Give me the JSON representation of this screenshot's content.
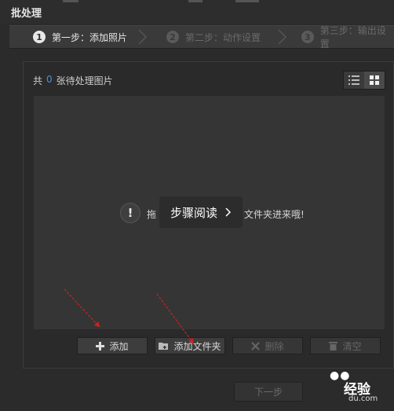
{
  "window": {
    "title": "批处理"
  },
  "steps": [
    {
      "num": "1",
      "label": "第一步：添加照片",
      "state": "active"
    },
    {
      "num": "2",
      "label": "第二步：动作设置",
      "state": "inactive"
    },
    {
      "num": "3",
      "label": "第三步：输出设置",
      "state": "inactive"
    }
  ],
  "panel": {
    "count_prefix": "共",
    "count_value": "0",
    "count_suffix": "张待处理图片"
  },
  "hint": {
    "text_start": "拖",
    "text_end": "文件夹进来哦!",
    "overlay_label": "步骤阅读"
  },
  "actions": {
    "add": "添加",
    "add_folder": "添加文件夹",
    "delete": "删除",
    "clear": "清空"
  },
  "footer": {
    "next": "下一步"
  },
  "watermark": {
    "text": "经验",
    "sub": "du.com"
  },
  "colors": {
    "accent": "#4a90d9",
    "annotation_arrow": "#cc2222"
  }
}
